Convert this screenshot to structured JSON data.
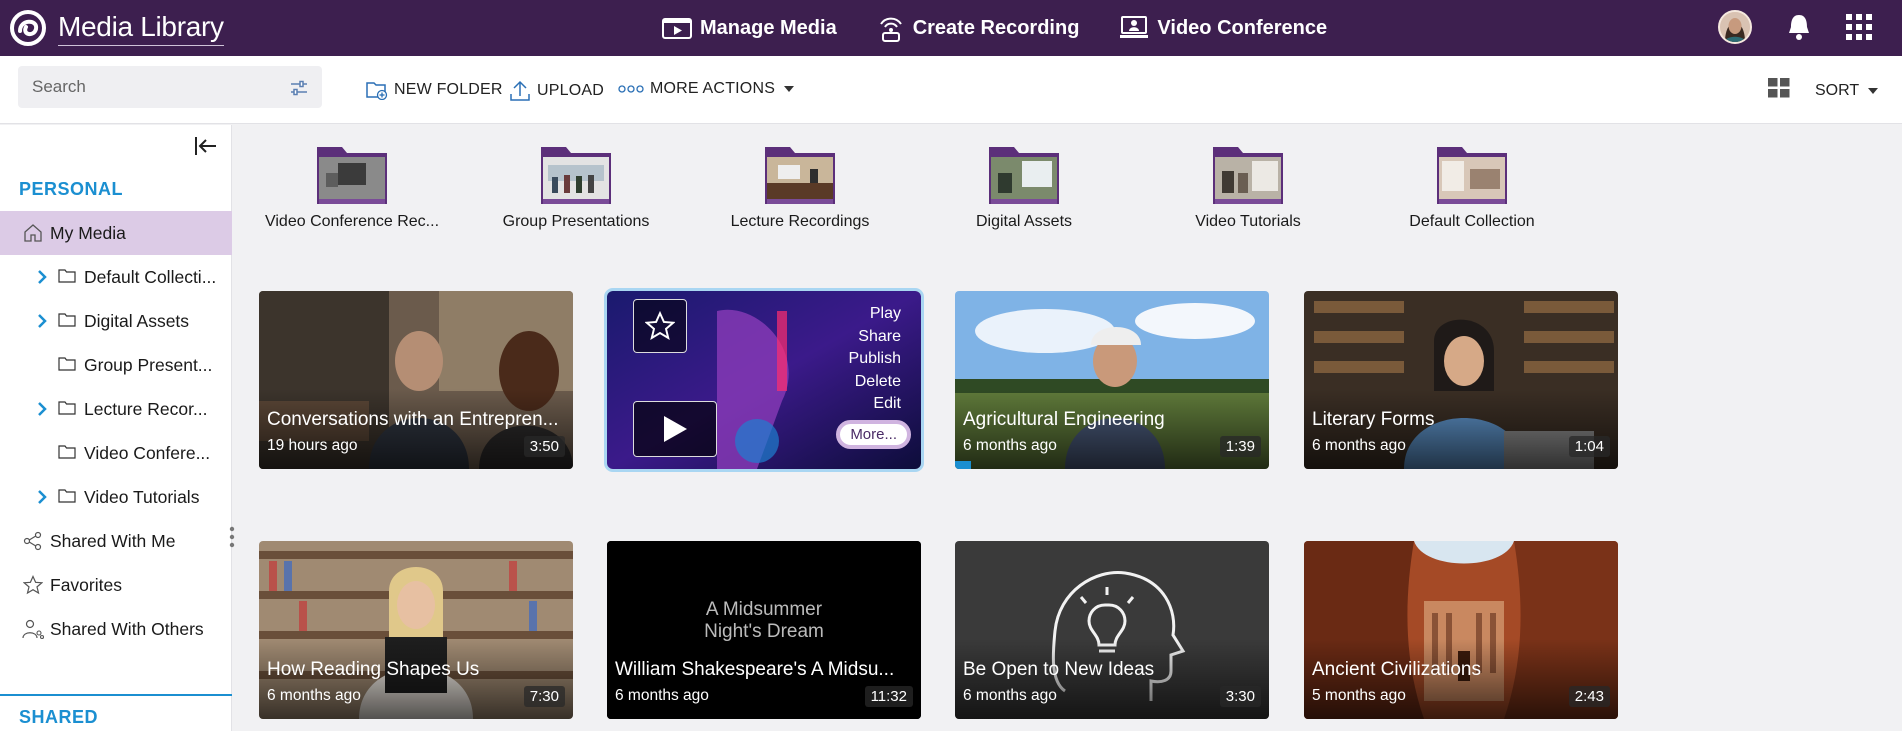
{
  "app": {
    "title": "Media Library"
  },
  "nav": [
    {
      "label": "Manage Media"
    },
    {
      "label": "Create Recording"
    },
    {
      "label": "Video Conference"
    }
  ],
  "toolbar": {
    "search_placeholder": "Search",
    "new_folder": "NEW FOLDER",
    "upload": "UPLOAD",
    "more_actions": "MORE ACTIONS",
    "sort": "SORT"
  },
  "sidebar": {
    "personal_title": "PERSONAL",
    "shared_title": "SHARED",
    "items": [
      {
        "label": "My Media"
      },
      {
        "label": "Default Collecti..."
      },
      {
        "label": "Digital Assets"
      },
      {
        "label": "Group Present..."
      },
      {
        "label": "Lecture Recor..."
      },
      {
        "label": "Video Confere..."
      },
      {
        "label": "Video Tutorials"
      },
      {
        "label": "Shared With Me"
      },
      {
        "label": "Favorites"
      },
      {
        "label": "Shared With Others"
      }
    ]
  },
  "folders": [
    {
      "label": "Video Conference Rec..."
    },
    {
      "label": "Group Presentations"
    },
    {
      "label": "Lecture Recordings"
    },
    {
      "label": "Digital Assets"
    },
    {
      "label": "Video Tutorials"
    },
    {
      "label": "Default Collection"
    }
  ],
  "cards": [
    {
      "title": "Conversations with an Entrepren...",
      "age": "19 hours ago",
      "duration": "3:50"
    },
    {
      "menu": [
        "Play",
        "Share",
        "Publish",
        "Delete",
        "Edit"
      ],
      "more": "More..."
    },
    {
      "title": "Agricultural Engineering",
      "age": "6 months ago",
      "duration": "1:39",
      "progress": 0.05
    },
    {
      "title": "Literary Forms",
      "age": "6 months ago",
      "duration": "1:04"
    },
    {
      "title": "How Reading Shapes Us",
      "age": "6 months ago",
      "duration": "7:30"
    },
    {
      "title": "William Shakespeare's A Midsu...",
      "age": "6 months ago",
      "duration": "11:32",
      "thumb_text": "A Midsummer Night's Dream"
    },
    {
      "title": "Be Open to New Ideas",
      "age": "6 months ago",
      "duration": "3:30"
    },
    {
      "title": "Ancient Civilizations",
      "age": "5 months ago",
      "duration": "2:43"
    }
  ],
  "colors": {
    "topbar": "#3d1f4f",
    "accent": "#1b8fd1",
    "active_item": "#dccbe6"
  }
}
